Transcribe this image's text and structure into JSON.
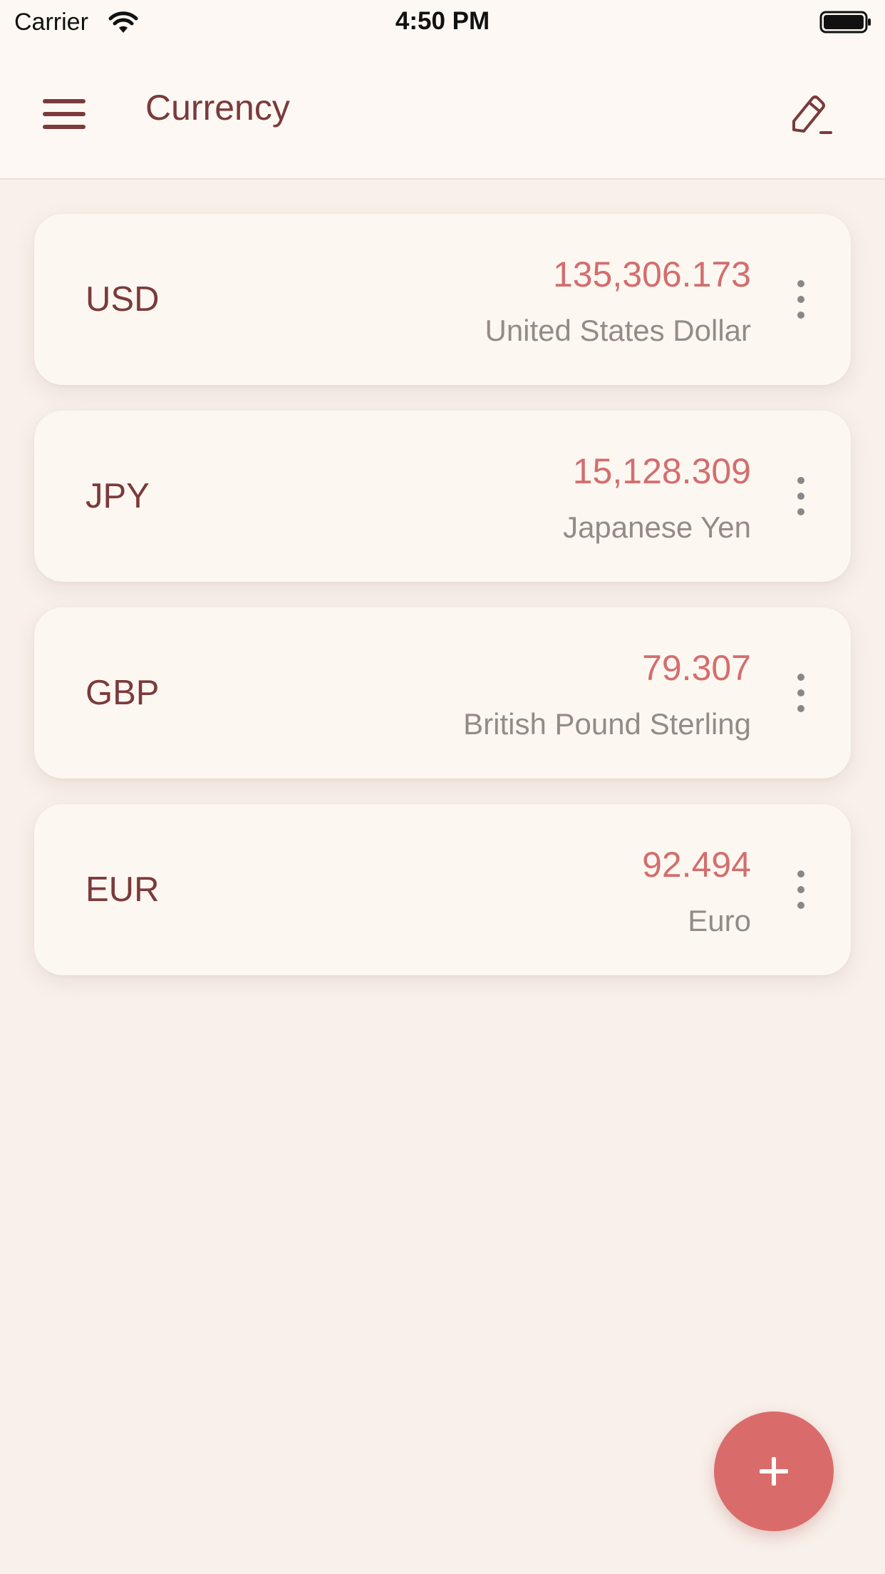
{
  "status_bar": {
    "carrier": "Carrier",
    "time": "4:50 PM",
    "wifi_icon": "wifi-icon",
    "battery_icon": "battery-icon"
  },
  "app_bar": {
    "title": "Currency",
    "menu_icon": "hamburger-menu-icon",
    "edit_icon": "pencil-edit-icon"
  },
  "currencies": [
    {
      "code": "USD",
      "amount": "135,306.173",
      "name": "United States Dollar"
    },
    {
      "code": "JPY",
      "amount": "15,128.309",
      "name": "Japanese Yen"
    },
    {
      "code": "GBP",
      "amount": "79.307",
      "name": "British Pound Sterling"
    },
    {
      "code": "EUR",
      "amount": "92.494",
      "name": "Euro"
    }
  ],
  "fab": {
    "icon": "plus-icon"
  },
  "colors": {
    "background": "#f8f0ea",
    "bar_background": "#fdf8f3",
    "card_background": "#fdf7f1",
    "primary_text": "#7b3a3c",
    "amount_text": "#d36e6e",
    "secondary_text": "#958b86",
    "accent": "#d96c6b"
  }
}
